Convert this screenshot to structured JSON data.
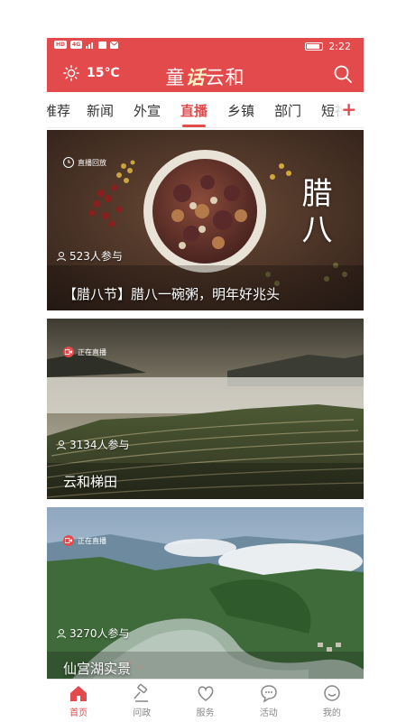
{
  "status_bar": {
    "time": "2:22",
    "indicators": [
      "HD",
      "4G",
      "signal",
      "msg",
      "mail"
    ]
  },
  "header": {
    "weather_icon": "sun-icon",
    "temperature": "15℃",
    "brand": {
      "prefix": "童",
      "accent": "话",
      "suffix": "云和"
    },
    "search_icon": "search-icon",
    "color": "#e24a4b"
  },
  "tabs": {
    "items": [
      "推荐",
      "新闻",
      "外宣",
      "直播",
      "乡镇",
      "部门",
      "短视"
    ],
    "active": "直播",
    "add_label": "+"
  },
  "cards": [
    {
      "badge": "直播回放",
      "participants": "523人参与",
      "title": "【腊八节】腊八一碗粥，明年好兆头",
      "overlay_text": "腊八"
    },
    {
      "badge": "正在直播",
      "participants": "3134人参与",
      "title": "云和梯田"
    },
    {
      "badge": "正在直播",
      "participants": "3270人参与",
      "title": "仙宫湖实景"
    }
  ],
  "bottom_nav": [
    {
      "label": "首页",
      "icon": "home-icon",
      "active": true
    },
    {
      "label": "问政",
      "icon": "gavel-icon",
      "active": false
    },
    {
      "label": "服务",
      "icon": "heart-icon",
      "active": false
    },
    {
      "label": "活动",
      "icon": "chat-icon",
      "active": false
    },
    {
      "label": "我的",
      "icon": "smile-icon",
      "active": false
    }
  ]
}
